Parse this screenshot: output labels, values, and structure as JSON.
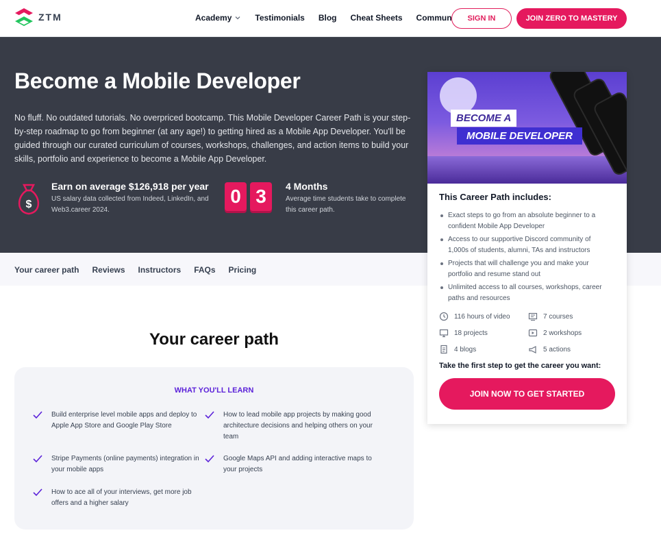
{
  "nav": {
    "logo_text": "ZTM",
    "links": [
      "Academy",
      "Testimonials",
      "Blog",
      "Cheat Sheets",
      "Community"
    ],
    "sign_in": "SIGN IN",
    "join": "JOIN ZERO TO MASTERY"
  },
  "hero": {
    "title": "Become a Mobile Developer",
    "description": "No fluff. No outdated tutorials. No overpriced bootcamp. This Mobile Developer Career Path is your step-by-step roadmap to go from beginner (at any age!) to getting hired as a Mobile App Developer. You'll be guided through our curated curriculum of courses, workshops, challenges, and action items to build your skills, portfolio and experience to become a Mobile App Developer.",
    "salary_title": "Earn on average $126,918 per year",
    "salary_sub": "US salary data collected from Indeed, LinkedIn, and Web3.career 2024.",
    "digits": [
      "0",
      "3"
    ],
    "months_title": "4 Months",
    "months_sub": "Average time students take to complete this career path."
  },
  "tabs": [
    "Your career path",
    "Reviews",
    "Instructors",
    "FAQs",
    "Pricing"
  ],
  "card": {
    "badge_line1": "BECOME A",
    "badge_line2": "MOBILE DEVELOPER",
    "includes_title": "This Career Path includes:",
    "includes": [
      "Exact steps to go from an absolute beginner to a confident Mobile App Developer",
      "Access to our supportive Discord community of 1,000s of students, alumni, TAs and instructors",
      "Projects that will challenge you and make your portfolio and resume stand out",
      "Unlimited access to all courses, workshops, career paths and resources"
    ],
    "features": [
      {
        "icon": "clock-icon",
        "label": "116 hours of video"
      },
      {
        "icon": "courses-icon",
        "label": "7 courses"
      },
      {
        "icon": "monitor-icon",
        "label": "18 projects"
      },
      {
        "icon": "play-icon",
        "label": "2 workshops"
      },
      {
        "icon": "document-icon",
        "label": "4 blogs"
      },
      {
        "icon": "megaphone-icon",
        "label": "5 actions"
      }
    ],
    "take_step": "Take the first step to get the career you want:",
    "cta": "JOIN NOW TO GET STARTED"
  },
  "career": {
    "title": "Your career path",
    "learn_head": "WHAT YOU'LL LEARN",
    "items": [
      "Build enterprise level mobile apps and deploy to Apple App Store and Google Play Store",
      "How to lead mobile app projects by making good architecture decisions and helping others on your team",
      "Stripe Payments (online payments) integration in your mobile apps",
      "Google Maps API and adding interactive maps to your projects",
      "How to ace all of your interviews, get more job offers and a higher salary"
    ]
  },
  "colors": {
    "accent": "#e5195e",
    "hero_bg": "#383c47",
    "purple": "#5b21d9"
  }
}
